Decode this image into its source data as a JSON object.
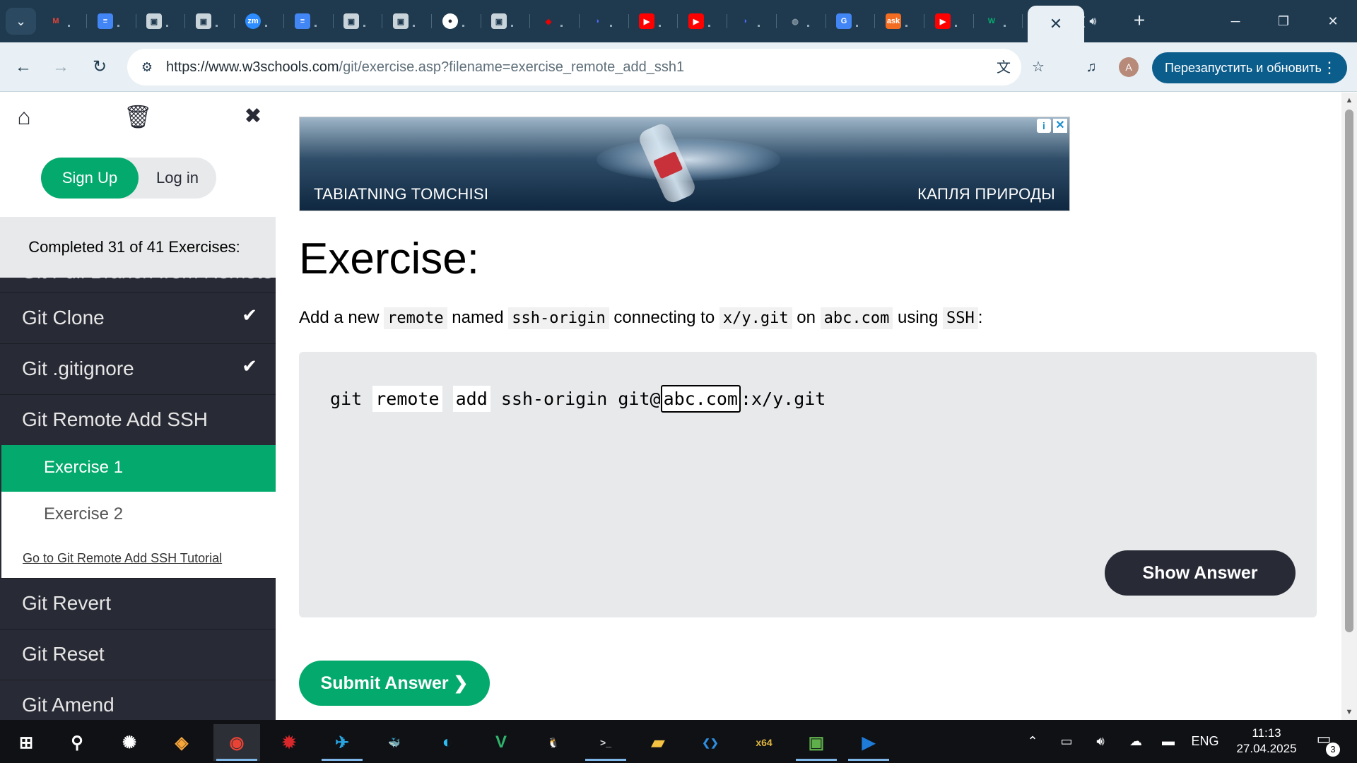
{
  "browser": {
    "url": {
      "host": "https://www.w3schools.com",
      "path": "/git/exercise.asp?filename=exercise_remote_add_ssh1"
    },
    "tabs": [
      {
        "icon": "gmail-icon",
        "glyph": "M",
        "color": "#ea4335"
      },
      {
        "icon": "docs-icon",
        "glyph": "≡",
        "color": "#4285f4"
      },
      {
        "icon": "account-icon",
        "glyph": "▣",
        "color": "#5f6f7a"
      },
      {
        "icon": "account-icon",
        "glyph": "▣",
        "color": "#5f6f7a"
      },
      {
        "icon": "zoom-icon",
        "glyph": "zm",
        "color": "#2d8cff"
      },
      {
        "icon": "docs-icon",
        "glyph": "≡",
        "color": "#4285f4"
      },
      {
        "icon": "account-icon",
        "glyph": "▣",
        "color": "#5f6f7a"
      },
      {
        "icon": "account-icon",
        "glyph": "▣",
        "color": "#5f6f7a"
      },
      {
        "icon": "github-icon",
        "glyph": "●",
        "color": "#24292f"
      },
      {
        "icon": "account-icon",
        "glyph": "▣",
        "color": "#5f6f7a"
      },
      {
        "icon": "redhat-icon",
        "glyph": "◆",
        "color": "#ee0000"
      },
      {
        "icon": "deepseek-icon",
        "glyph": "◗",
        "color": "#4d6bfe"
      },
      {
        "icon": "youtube-icon",
        "glyph": "▶",
        "color": "#ff0000"
      },
      {
        "icon": "youtube-icon",
        "glyph": "▶",
        "color": "#ff0000"
      },
      {
        "icon": "deepseek-icon",
        "glyph": "◗",
        "color": "#4d6bfe"
      },
      {
        "icon": "globe-icon",
        "glyph": "◍",
        "color": "#8a9aa6"
      },
      {
        "icon": "translate-icon",
        "glyph": "G",
        "color": "#4285f4"
      },
      {
        "icon": "ask-icon",
        "glyph": "ask",
        "color": "#f26c22"
      },
      {
        "icon": "youtube-icon",
        "glyph": "▶",
        "color": "#ff0000"
      },
      {
        "icon": "w3schools-icon",
        "glyph": "W",
        "color": "#04aa6d"
      }
    ],
    "audio_tab_label": "(",
    "relaunch_label": "Перезапустить и обновить",
    "profile_initial": "A"
  },
  "sidebar": {
    "auth": {
      "signup": "Sign Up",
      "login": "Log in"
    },
    "progress": "Completed 31 of 41 Exercises:",
    "partial_item": "Git Pull Branch from Remote",
    "items_before": [
      {
        "label": "Git Clone",
        "completed": true
      },
      {
        "label": "Git .gitignore",
        "completed": true
      },
      {
        "label": "Git Remote Add SSH",
        "completed": false
      }
    ],
    "sub_exercises": [
      {
        "label": "Exercise 1",
        "active": true
      },
      {
        "label": "Exercise 2",
        "active": false
      }
    ],
    "tutorial_link": "Go to Git Remote Add SSH Tutorial",
    "items_after": [
      {
        "label": "Git Revert"
      },
      {
        "label": "Git Reset"
      },
      {
        "label": "Git Amend"
      }
    ]
  },
  "ad": {
    "left_text": "TABIATNING TOMCHISI",
    "right_text": "КАПЛЯ ПРИРОДЫ"
  },
  "exercise": {
    "title": "Exercise:",
    "instruction": [
      {
        "text": "Add a new ",
        "code": false
      },
      {
        "text": "remote",
        "code": true
      },
      {
        "text": " named ",
        "code": false
      },
      {
        "text": "ssh-origin",
        "code": true
      },
      {
        "text": " connecting to ",
        "code": false
      },
      {
        "text": "x/y.git",
        "code": true
      },
      {
        "text": " on ",
        "code": false
      },
      {
        "text": "abc.com",
        "code": true
      },
      {
        "text": " using ",
        "code": false
      },
      {
        "text": "SSH",
        "code": true
      },
      {
        "text": ":",
        "code": false
      }
    ],
    "code": {
      "part1": "git",
      "chip1": "remote",
      "chip2": "add",
      "part2": "ssh-origin git@",
      "input_value": "abc.com",
      "part3": ":x/y.git"
    },
    "show_answer": "Show Answer",
    "submit": "Submit Answer ❯"
  },
  "taskbar": {
    "apps": [
      {
        "name": "start-icon",
        "glyph": "⊞",
        "color": "#ffffff"
      },
      {
        "name": "search-icon",
        "glyph": "⚲",
        "color": "#ffffff"
      },
      {
        "name": "chatgpt-icon",
        "glyph": "✺",
        "color": "#ffffff"
      },
      {
        "name": "copilot-icon",
        "glyph": "◈",
        "color": "#f6a63b"
      },
      {
        "name": "chrome-icon",
        "glyph": "◉",
        "color": "#ea4335"
      },
      {
        "name": "antivirus-icon",
        "glyph": "✹",
        "color": "#d8282b"
      },
      {
        "name": "telegram-icon",
        "glyph": "✈",
        "color": "#2aa3e1"
      },
      {
        "name": "docker-icon",
        "glyph": "🐳",
        "color": "#2496ed"
      },
      {
        "name": "edge-icon",
        "glyph": "◐",
        "color": "#2ebef0"
      },
      {
        "name": "veeam-icon",
        "glyph": "V",
        "color": "#2fb56b"
      },
      {
        "name": "linux-icon",
        "glyph": "🐧",
        "color": "#ffffff"
      },
      {
        "name": "terminal-icon",
        "glyph": ">_",
        "color": "#cfd3d8"
      },
      {
        "name": "folder-icon",
        "glyph": "▰",
        "color": "#f5c342"
      },
      {
        "name": "vscode-icon",
        "glyph": "❮❯",
        "color": "#2f8ee0"
      },
      {
        "name": "x64dbg-icon",
        "glyph": "x64",
        "color": "#e0b640"
      },
      {
        "name": "remote-desktop-icon",
        "glyph": "▣",
        "color": "#5fb04b"
      },
      {
        "name": "media-player-icon",
        "glyph": "▶",
        "color": "#1e7bd8"
      }
    ],
    "language": "ENG",
    "time": "11:13",
    "date": "27.04.2025",
    "notifications": "3"
  }
}
